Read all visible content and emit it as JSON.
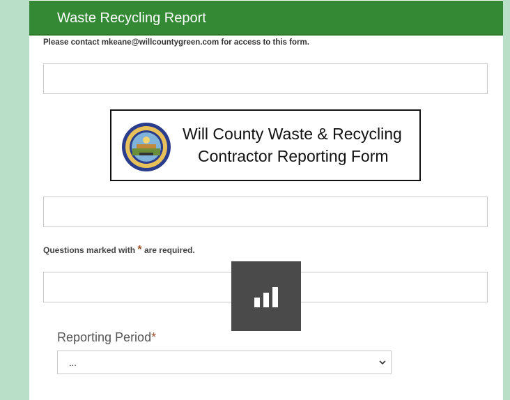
{
  "header": {
    "title": "Waste Recycling Report",
    "bg_color": "#348a34"
  },
  "contact_note": "Please contact mkeane@willcountygreen.com for access to this form.",
  "banner": {
    "line1": "Will County Waste & Recycling",
    "line2": "Contractor Reporting Form",
    "seal_text_top": "THE COUNTY OF WILL",
    "seal_text_bottom": "ILLINOIS"
  },
  "required_note": {
    "prefix": "Questions marked with",
    "star": "*",
    "suffix": "are required."
  },
  "reporting_period": {
    "label": "Reporting Period",
    "star": "*",
    "selected": "..."
  },
  "colors": {
    "background": "#b9dfc9",
    "required_star": "#a0522d",
    "loading_overlay": "#4a4a4a"
  },
  "icons": {
    "loading": "bar-chart-icon",
    "dropdown": "chevron-down-icon"
  }
}
